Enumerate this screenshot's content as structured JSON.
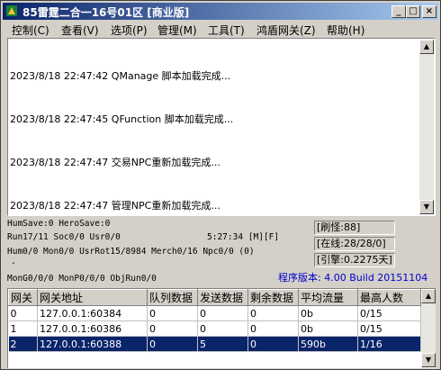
{
  "window": {
    "title": "85雷霆二合一16号01区 [商业版]",
    "controls": [
      "_",
      "□",
      "×"
    ]
  },
  "menu": [
    "控制(C)",
    "查看(V)",
    "选项(P)",
    "管理(M)",
    "工具(T)",
    "鸿盾网关(Z)",
    "帮助(H)"
  ],
  "log": [
    "2023/8/18 22:47:42 QManage 脚本加载完成...",
    "2023/8/18 22:47:45 QFunction 脚本加载完成...",
    "2023/8/18 22:47:47 交易NPC重新加载完成...",
    "2023/8/18 22:47:47 管理NPC重新加载完成..."
  ],
  "status": {
    "line1": "HumSave:0 HeroSave:0",
    "line2": "Run17/11 Soc0/0 Usr0/0",
    "time": "5:27:34 [M][F]",
    "line3": "Hum0/0 Mon0/0 UsrRot15/8984 Merch0/16 Npc0/0 (0)",
    "line4": "-",
    "line5": "MonG0/0/0 MonP0/0/0 ObjRun0/0",
    "refresh": "[刷怪:88]",
    "online": "[在线:28/28/0]",
    "engine": "[引擎:0.2275天]",
    "version": "程序版本: 4.00 Build 20151104"
  },
  "table": {
    "headers": [
      "网关",
      "网关地址",
      "队列数据",
      "发送数据",
      "剩余数据",
      "平均流量",
      "最高人数"
    ],
    "rows": [
      [
        "0",
        "127.0.0.1:60384",
        "0",
        "0",
        "0",
        "0b",
        "0/15"
      ],
      [
        "1",
        "127.0.0.1:60386",
        "0",
        "0",
        "0",
        "0b",
        "0/15"
      ],
      [
        "2",
        "127.0.0.1:60388",
        "0",
        "5",
        "0",
        "590b",
        "1/16"
      ]
    ],
    "selected_row": 2
  },
  "colors": {
    "titlebar_start": "#0a246a",
    "titlebar_end": "#a6caf0",
    "version_text": "#0000cc",
    "selection": "#0a246a"
  }
}
